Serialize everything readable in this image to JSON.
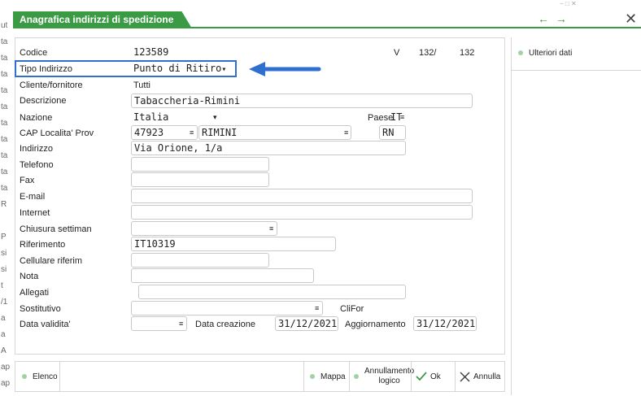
{
  "window": {
    "title": "Anagrafica indirizzi di spedizione",
    "nav_arrows": "← →",
    "close_glyph": "✕",
    "tiny_icons": "− □ ✕"
  },
  "left_strip": [
    "ut",
    "ta",
    "ta",
    "ta",
    "ta",
    "ta",
    "ta",
    "ta",
    "ta",
    "ta",
    "ta",
    "R",
    "",
    "P",
    "si",
    "si",
    "t",
    "/1",
    "a",
    "a",
    "A",
    "ap",
    "ap"
  ],
  "form": {
    "codice": {
      "label": "Codice",
      "value": "123589",
      "v_label": "V",
      "v_num": "132/",
      "v_total": "132"
    },
    "tipo_indirizzo": {
      "label": "Tipo Indirizzo",
      "value": "Punto di Ritiro"
    },
    "cliente_fornitore": {
      "label": "Cliente/fornitore",
      "value": "Tutti"
    },
    "descrizione": {
      "label": "Descrizione",
      "value": "Tabaccheria-Rimini"
    },
    "nazione": {
      "label": "Nazione",
      "value": "Italia",
      "paese_label": "Paese",
      "paese_value": "IT"
    },
    "cap": {
      "label": "CAP Localita' Prov",
      "cap_value": "47923",
      "localita_value": "RIMINI",
      "prov_value": "RN"
    },
    "indirizzo": {
      "label": "Indirizzo",
      "value": "Via Orione, 1/a"
    },
    "telefono": {
      "label": "Telefono",
      "value": ""
    },
    "fax": {
      "label": "Fax",
      "value": ""
    },
    "email": {
      "label": "E-mail",
      "value": ""
    },
    "internet": {
      "label": "Internet",
      "value": ""
    },
    "chiusura": {
      "label": "Chiusura settiman",
      "value": ""
    },
    "riferimento": {
      "label": "Riferimento",
      "value": "IT10319"
    },
    "cellulare": {
      "label": "Cellulare riferim",
      "value": ""
    },
    "nota": {
      "label": "Nota",
      "value": ""
    },
    "allegati": {
      "label": "Allegati",
      "value": ""
    },
    "sostitutivo": {
      "label": "Sostitutivo",
      "value": "",
      "clifor_label": "CliFor"
    },
    "data_validita": {
      "label": "Data validita'",
      "value": "",
      "creazione_label": "Data creazione",
      "creazione_value": "31/12/2021",
      "aggiornamento_label": "Aggiornamento",
      "aggiornamento_value": "31/12/2021"
    }
  },
  "right_panel": {
    "item": "Ulteriori dati"
  },
  "buttons": {
    "elenco": "Elenco",
    "mappa": "Mappa",
    "annullamento_line1": "Annullamento",
    "annullamento_line2": "logico",
    "ok": "Ok",
    "annulla": "Annulla"
  },
  "icons": {
    "menu_mark": "≡",
    "dropdown": "▾",
    "ok": "check-icon",
    "annulla": "close-icon"
  },
  "colors": {
    "accent": "#3b9b45",
    "highlight": "#2f6fd0",
    "dot": "#9fd3a3"
  }
}
